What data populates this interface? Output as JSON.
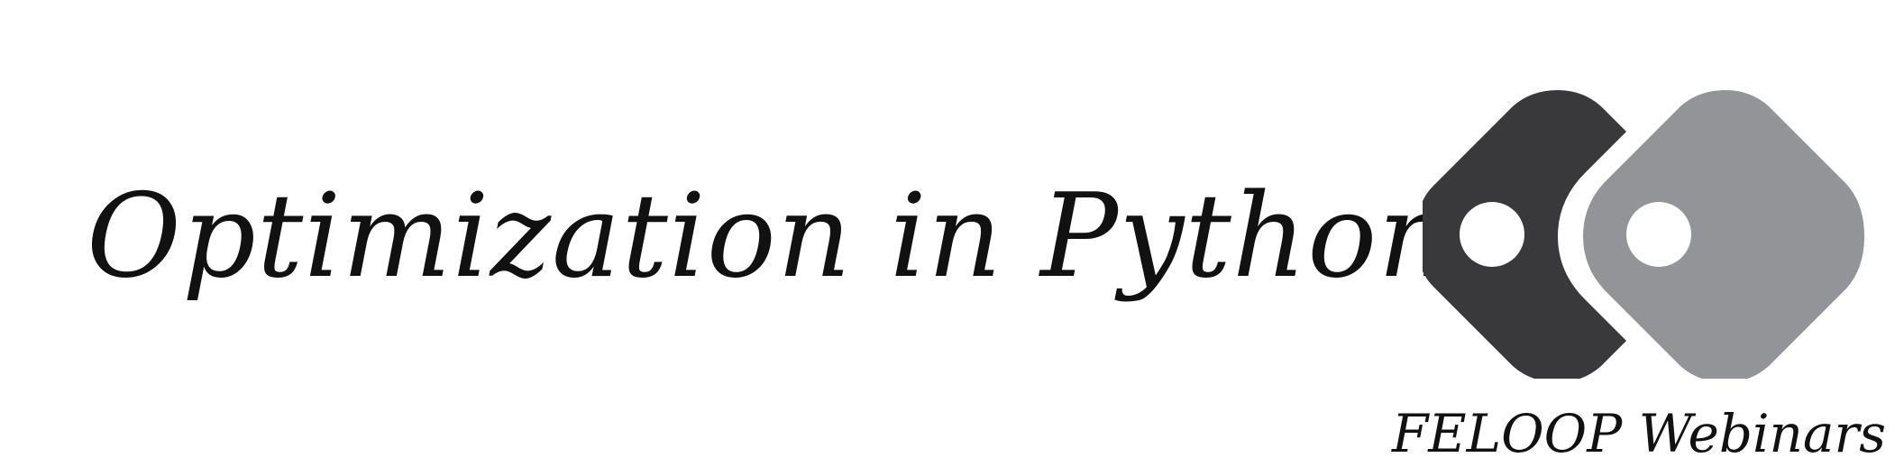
{
  "banner": {
    "title": "Optimization in Python",
    "subtitle": "FELOOP Webinars",
    "logo": {
      "icon": "feloop-logo-icon",
      "left_shape_color": "#39383b",
      "right_shape_color": "#939497",
      "eye_color": "#ffffff"
    },
    "text_color": "#111111",
    "background_color": "#ffffff"
  }
}
